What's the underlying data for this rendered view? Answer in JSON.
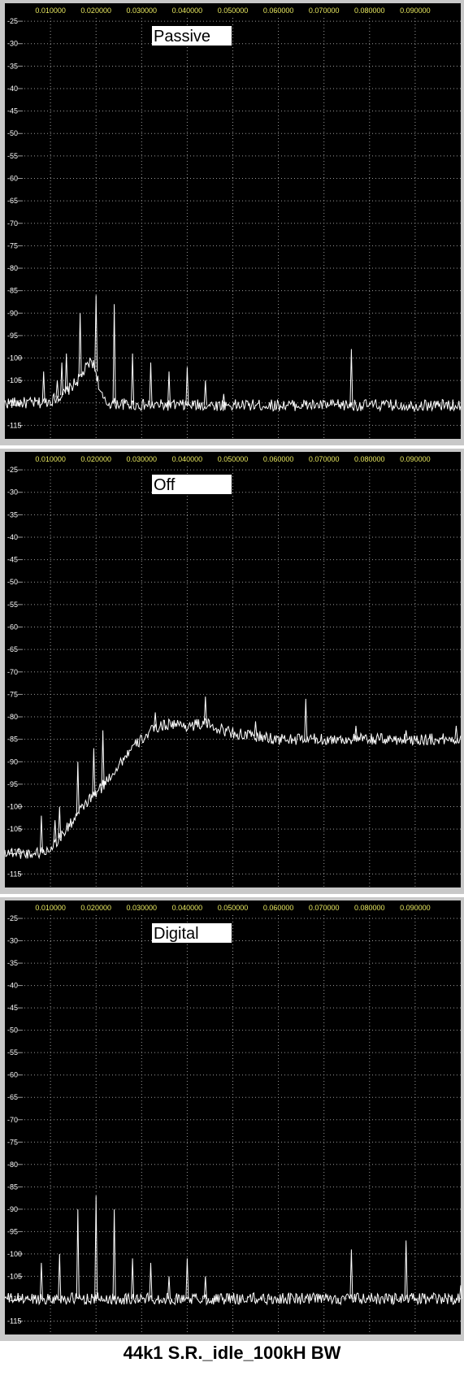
{
  "caption": "44k1 S.R._idle_100kH BW",
  "colors": {
    "plot_background": "#000000",
    "grid": "#9a9a9a",
    "trace": "#ffffff",
    "x_tick_text": "#e8e860",
    "y_tick_text": "#ffffff",
    "frame": "#c8c8c8"
  },
  "chart_data": [
    {
      "type": "line",
      "label": "Passive",
      "xlim": [
        0.0,
        0.1
      ],
      "ylim": [
        -118,
        -21
      ],
      "grid": true,
      "x_ticks": [
        "0.010000",
        "0.020000",
        "0.030000",
        "0.040000",
        "0.050000",
        "0.060000",
        "0.070000",
        "0.080000",
        "0.090000"
      ],
      "y_ticks": [
        "-25",
        "-30",
        "-35",
        "-40",
        "-45",
        "-50",
        "-55",
        "-60",
        "-65",
        "-70",
        "-75",
        "-80",
        "-85",
        "-90",
        "-95",
        "-100",
        "-105",
        "-110",
        "-115"
      ],
      "floor_points": [
        [
          0,
          -110
        ],
        [
          0.008,
          -110
        ],
        [
          0.01,
          -109.5
        ],
        [
          0.013,
          -108
        ],
        [
          0.016,
          -105
        ],
        [
          0.018,
          -102
        ],
        [
          0.019,
          -100.5
        ],
        [
          0.02,
          -103
        ],
        [
          0.021,
          -108
        ],
        [
          0.022,
          -110
        ],
        [
          0.03,
          -110.5
        ],
        [
          0.05,
          -110.5
        ],
        [
          0.075,
          -110.5
        ],
        [
          0.1,
          -110.5
        ]
      ],
      "spikes": [
        [
          0.0085,
          -103
        ],
        [
          0.0115,
          -105
        ],
        [
          0.0125,
          -101
        ],
        [
          0.0135,
          -99
        ],
        [
          0.0165,
          -90
        ],
        [
          0.02,
          -86
        ],
        [
          0.024,
          -88
        ],
        [
          0.028,
          -99
        ],
        [
          0.032,
          -101
        ],
        [
          0.036,
          -103
        ],
        [
          0.04,
          -102
        ],
        [
          0.044,
          -105
        ],
        [
          0.048,
          -108
        ],
        [
          0.076,
          -98
        ]
      ]
    },
    {
      "type": "line",
      "label": "Off",
      "xlim": [
        0.0,
        0.1
      ],
      "ylim": [
        -118,
        -21
      ],
      "grid": true,
      "x_ticks": [
        "0.010000",
        "0.020000",
        "0.030000",
        "0.040000",
        "0.050000",
        "0.060000",
        "0.070000",
        "0.080000",
        "0.090000"
      ],
      "y_ticks": [
        "-25",
        "-30",
        "-35",
        "-40",
        "-45",
        "-50",
        "-55",
        "-60",
        "-65",
        "-70",
        "-75",
        "-80",
        "-85",
        "-90",
        "-95",
        "-100",
        "-105",
        "-110",
        "-115"
      ],
      "floor_points": [
        [
          0,
          -110
        ],
        [
          0.005,
          -110.5
        ],
        [
          0.009,
          -110
        ],
        [
          0.012,
          -107
        ],
        [
          0.015,
          -103
        ],
        [
          0.018,
          -99
        ],
        [
          0.021,
          -96
        ],
        [
          0.024,
          -92
        ],
        [
          0.027,
          -88
        ],
        [
          0.03,
          -85
        ],
        [
          0.033,
          -82.5
        ],
        [
          0.036,
          -81.5
        ],
        [
          0.04,
          -82
        ],
        [
          0.044,
          -81.5
        ],
        [
          0.048,
          -83
        ],
        [
          0.052,
          -84
        ],
        [
          0.056,
          -84.5
        ],
        [
          0.06,
          -85
        ],
        [
          0.07,
          -85
        ],
        [
          0.08,
          -85
        ],
        [
          0.09,
          -85
        ],
        [
          0.1,
          -85
        ]
      ],
      "spikes": [
        [
          0.008,
          -102
        ],
        [
          0.011,
          -103
        ],
        [
          0.012,
          -100
        ],
        [
          0.016,
          -90
        ],
        [
          0.0195,
          -87
        ],
        [
          0.0215,
          -83
        ],
        [
          0.033,
          -79
        ],
        [
          0.044,
          -75.5
        ],
        [
          0.055,
          -81
        ],
        [
          0.066,
          -76
        ],
        [
          0.077,
          -82
        ],
        [
          0.088,
          -83
        ],
        [
          0.099,
          -82
        ]
      ]
    },
    {
      "type": "line",
      "label": "Digital",
      "xlim": [
        0.0,
        0.1
      ],
      "ylim": [
        -118,
        -21
      ],
      "grid": true,
      "x_ticks": [
        "0.010000",
        "0.020000",
        "0.030000",
        "0.040000",
        "0.050000",
        "0.060000",
        "0.070000",
        "0.080000",
        "0.090000"
      ],
      "y_ticks": [
        "-25",
        "-30",
        "-35",
        "-40",
        "-45",
        "-50",
        "-55",
        "-60",
        "-65",
        "-70",
        "-75",
        "-80",
        "-85",
        "-90",
        "-95",
        "-100",
        "-105",
        "-110",
        "-115"
      ],
      "floor_points": [
        [
          0,
          -110
        ],
        [
          0.1,
          -110
        ]
      ],
      "spikes": [
        [
          0.008,
          -102
        ],
        [
          0.012,
          -100
        ],
        [
          0.016,
          -90
        ],
        [
          0.02,
          -87
        ],
        [
          0.024,
          -90
        ],
        [
          0.028,
          -101
        ],
        [
          0.032,
          -102
        ],
        [
          0.036,
          -105
        ],
        [
          0.04,
          -101
        ],
        [
          0.044,
          -105
        ],
        [
          0.076,
          -99
        ],
        [
          0.088,
          -97
        ],
        [
          0.1,
          -107
        ]
      ]
    }
  ]
}
